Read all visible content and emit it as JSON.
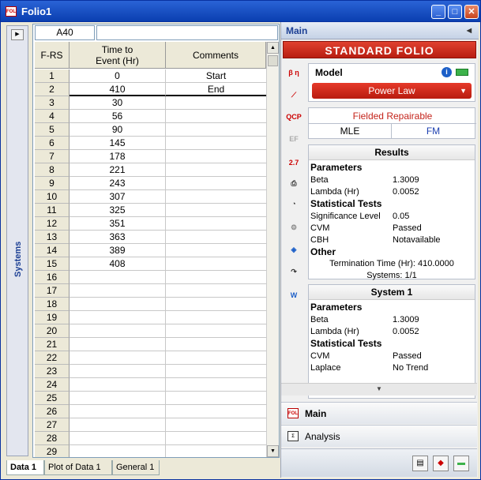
{
  "window": {
    "title": "Folio1"
  },
  "sidebar": {
    "label": "Systems"
  },
  "sheet": {
    "name_box": "A40",
    "formula": "",
    "headers": {
      "rownum": "F-RS",
      "time_line1": "Time to",
      "time_line2": "Event (Hr)",
      "comments": "Comments"
    },
    "rows": [
      {
        "n": "1",
        "time": "0",
        "comment": "Start"
      },
      {
        "n": "2",
        "time": "410",
        "comment": "End"
      },
      {
        "n": "3",
        "time": "30",
        "comment": ""
      },
      {
        "n": "4",
        "time": "56",
        "comment": ""
      },
      {
        "n": "5",
        "time": "90",
        "comment": ""
      },
      {
        "n": "6",
        "time": "145",
        "comment": ""
      },
      {
        "n": "7",
        "time": "178",
        "comment": ""
      },
      {
        "n": "8",
        "time": "221",
        "comment": ""
      },
      {
        "n": "9",
        "time": "243",
        "comment": ""
      },
      {
        "n": "10",
        "time": "307",
        "comment": ""
      },
      {
        "n": "11",
        "time": "325",
        "comment": ""
      },
      {
        "n": "12",
        "time": "351",
        "comment": ""
      },
      {
        "n": "13",
        "time": "363",
        "comment": ""
      },
      {
        "n": "14",
        "time": "389",
        "comment": ""
      },
      {
        "n": "15",
        "time": "408",
        "comment": ""
      },
      {
        "n": "16",
        "time": "",
        "comment": ""
      },
      {
        "n": "17",
        "time": "",
        "comment": ""
      },
      {
        "n": "18",
        "time": "",
        "comment": ""
      },
      {
        "n": "19",
        "time": "",
        "comment": ""
      },
      {
        "n": "20",
        "time": "",
        "comment": ""
      },
      {
        "n": "21",
        "time": "",
        "comment": ""
      },
      {
        "n": "22",
        "time": "",
        "comment": ""
      },
      {
        "n": "23",
        "time": "",
        "comment": ""
      },
      {
        "n": "24",
        "time": "",
        "comment": ""
      },
      {
        "n": "25",
        "time": "",
        "comment": ""
      },
      {
        "n": "26",
        "time": "",
        "comment": ""
      },
      {
        "n": "27",
        "time": "",
        "comment": ""
      },
      {
        "n": "28",
        "time": "",
        "comment": ""
      },
      {
        "n": "29",
        "time": "",
        "comment": ""
      }
    ]
  },
  "tabs": [
    "Data 1",
    "Plot of Data 1",
    "General 1"
  ],
  "panel": {
    "header": "Main",
    "banner": "STANDARD FOLIO",
    "model_label": "Model",
    "model_value": "Power Law",
    "data_type": "Fielded Repairable",
    "method_mle": "MLE",
    "method_fm": "FM",
    "results": {
      "title": "Results",
      "parameters": "Parameters",
      "beta_label": "Beta",
      "beta": "1.3009",
      "lambda_label": "Lambda (Hr)",
      "lambda": "0.0052",
      "stat_tests": "Statistical Tests",
      "sig_label": "Significance Level",
      "sig": "0.05",
      "cvm_label": "CVM",
      "cvm": "Passed",
      "cbh_label": "CBH",
      "cbh": "Notavailable",
      "other": "Other",
      "termination": "Termination Time (Hr): 410.0000",
      "systems": "Systems: 1/1"
    },
    "system1": {
      "title": "System 1",
      "parameters": "Parameters",
      "beta_label": "Beta",
      "beta": "1.3009",
      "lambda_label": "Lambda (Hr)",
      "lambda": "0.0052",
      "stat_tests": "Statistical Tests",
      "cvm_label": "CVM",
      "cvm": "Passed",
      "laplace_label": "Laplace",
      "laplace": "No Trend"
    },
    "nav_main": "Main",
    "nav_analysis": "Analysis"
  }
}
